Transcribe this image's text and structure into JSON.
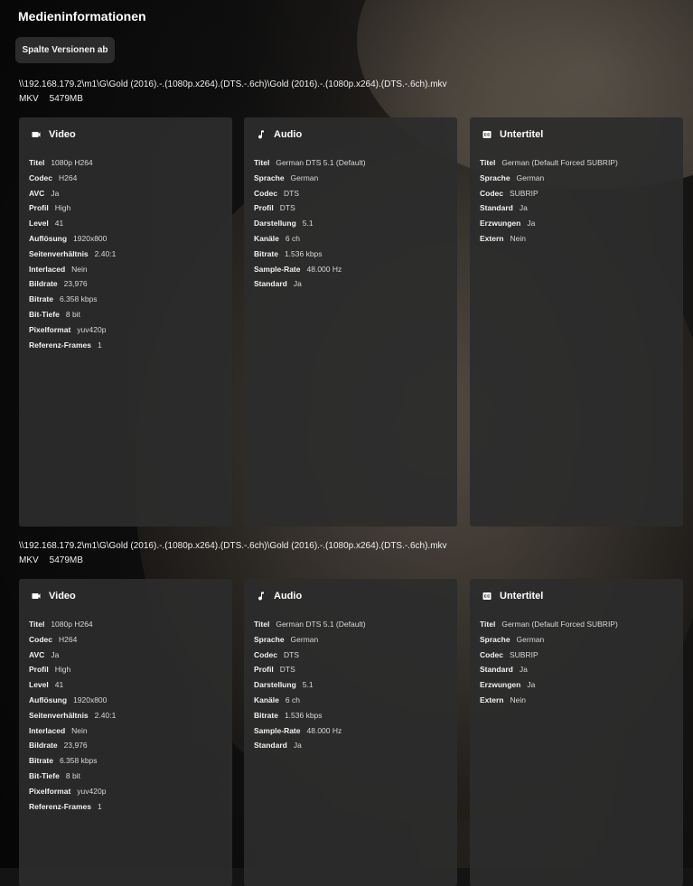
{
  "page": {
    "title": "Medieninformationen"
  },
  "toolbar": {
    "split_label": "Spalte Versionen ab"
  },
  "versions": [
    {
      "path": "\\\\192.168.179.2\\m1\\G\\Gold (2016).-.(1080p.x264).(DTS.-.6ch)\\Gold (2016).-.(1080p.x264).(DTS.-.6ch).mkv",
      "container": "MKV",
      "size": "5479MB",
      "video": {
        "title": "Video",
        "rows": [
          {
            "k": "Titel",
            "v": "1080p H264"
          },
          {
            "k": "Codec",
            "v": "H264"
          },
          {
            "k": "AVC",
            "v": "Ja"
          },
          {
            "k": "Profil",
            "v": "High"
          },
          {
            "k": "Level",
            "v": "41"
          },
          {
            "k": "Auflösung",
            "v": "1920x800"
          },
          {
            "k": "Seitenverhältnis",
            "v": "2.40:1"
          },
          {
            "k": "Interlaced",
            "v": "Nein"
          },
          {
            "k": "Bildrate",
            "v": "23,976"
          },
          {
            "k": "Bitrate",
            "v": "6.358 kbps"
          },
          {
            "k": "Bit-Tiefe",
            "v": "8 bit"
          },
          {
            "k": "Pixelformat",
            "v": "yuv420p"
          },
          {
            "k": "Referenz-Frames",
            "v": "1"
          }
        ]
      },
      "audio": {
        "title": "Audio",
        "rows": [
          {
            "k": "Titel",
            "v": "German DTS 5.1 (Default)"
          },
          {
            "k": "Sprache",
            "v": "German"
          },
          {
            "k": "Codec",
            "v": "DTS"
          },
          {
            "k": "Profil",
            "v": "DTS"
          },
          {
            "k": "Darstellung",
            "v": "5.1"
          },
          {
            "k": "Kanäle",
            "v": "6 ch"
          },
          {
            "k": "Bitrate",
            "v": "1.536 kbps"
          },
          {
            "k": "Sample-Rate",
            "v": "48.000 Hz"
          },
          {
            "k": "Standard",
            "v": "Ja"
          }
        ]
      },
      "subtitle": {
        "title": "Untertitel",
        "rows": [
          {
            "k": "Titel",
            "v": "German (Default Forced SUBRIP)"
          },
          {
            "k": "Sprache",
            "v": "German"
          },
          {
            "k": "Codec",
            "v": "SUBRIP"
          },
          {
            "k": "Standard",
            "v": "Ja"
          },
          {
            "k": "Erzwungen",
            "v": "Ja"
          },
          {
            "k": "Extern",
            "v": "Nein"
          }
        ]
      }
    },
    {
      "path": "\\\\192.168.179.2\\m1\\G\\Gold (2016).-.(1080p.x264).(DTS.-.6ch)\\Gold (2016).-.(1080p.x264).(DTS.-.6ch).mkv",
      "container": "MKV",
      "size": "5479MB",
      "video": {
        "title": "Video",
        "rows": [
          {
            "k": "Titel",
            "v": "1080p H264"
          },
          {
            "k": "Codec",
            "v": "H264"
          },
          {
            "k": "AVC",
            "v": "Ja"
          },
          {
            "k": "Profil",
            "v": "High"
          },
          {
            "k": "Level",
            "v": "41"
          },
          {
            "k": "Auflösung",
            "v": "1920x800"
          },
          {
            "k": "Seitenverhältnis",
            "v": "2.40:1"
          },
          {
            "k": "Interlaced",
            "v": "Nein"
          },
          {
            "k": "Bildrate",
            "v": "23,976"
          },
          {
            "k": "Bitrate",
            "v": "6.358 kbps"
          },
          {
            "k": "Bit-Tiefe",
            "v": "8 bit"
          },
          {
            "k": "Pixelformat",
            "v": "yuv420p"
          },
          {
            "k": "Referenz-Frames",
            "v": "1"
          }
        ]
      },
      "audio": {
        "title": "Audio",
        "rows": [
          {
            "k": "Titel",
            "v": "German DTS 5.1 (Default)"
          },
          {
            "k": "Sprache",
            "v": "German"
          },
          {
            "k": "Codec",
            "v": "DTS"
          },
          {
            "k": "Profil",
            "v": "DTS"
          },
          {
            "k": "Darstellung",
            "v": "5.1"
          },
          {
            "k": "Kanäle",
            "v": "6 ch"
          },
          {
            "k": "Bitrate",
            "v": "1.536 kbps"
          },
          {
            "k": "Sample-Rate",
            "v": "48.000 Hz"
          },
          {
            "k": "Standard",
            "v": "Ja"
          }
        ]
      },
      "subtitle": {
        "title": "Untertitel",
        "rows": [
          {
            "k": "Titel",
            "v": "German (Default Forced SUBRIP)"
          },
          {
            "k": "Sprache",
            "v": "German"
          },
          {
            "k": "Codec",
            "v": "SUBRIP"
          },
          {
            "k": "Standard",
            "v": "Ja"
          },
          {
            "k": "Erzwungen",
            "v": "Ja"
          },
          {
            "k": "Extern",
            "v": "Nein"
          }
        ]
      }
    }
  ]
}
